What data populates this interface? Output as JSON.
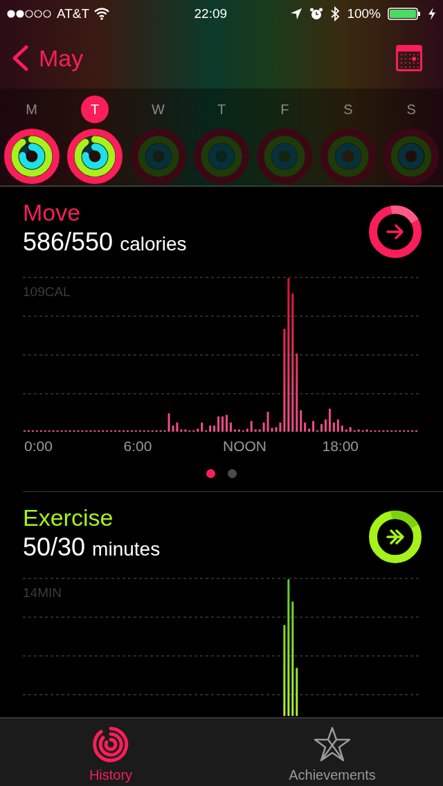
{
  "status_bar": {
    "carrier": "AT&T",
    "time": "22:09",
    "battery": "100%"
  },
  "nav": {
    "back_label": "May"
  },
  "week": [
    {
      "letter": "M",
      "selected": false,
      "active": true
    },
    {
      "letter": "T",
      "selected": true,
      "active": true
    },
    {
      "letter": "W",
      "selected": false,
      "active": false
    },
    {
      "letter": "T",
      "selected": false,
      "active": false
    },
    {
      "letter": "F",
      "selected": false,
      "active": false
    },
    {
      "letter": "S",
      "selected": false,
      "active": false
    },
    {
      "letter": "S",
      "selected": false,
      "active": false
    }
  ],
  "sections": [
    {
      "kind": "move",
      "title": "Move",
      "value": "586/550",
      "unit": "calories",
      "y_label": "109CAL",
      "x_labels": [
        "0:00",
        "6:00",
        "NOON",
        "18:00"
      ],
      "pages": [
        {
          "selected": true
        },
        {
          "selected": false
        }
      ]
    },
    {
      "kind": "exercise",
      "title": "Exercise",
      "value": "50/30",
      "unit": "minutes",
      "y_label": "14MIN"
    }
  ],
  "tabs": [
    {
      "kind": "history",
      "label": "History",
      "selected": true
    },
    {
      "kind": "achievements",
      "label": "Achievements",
      "selected": false
    }
  ]
}
